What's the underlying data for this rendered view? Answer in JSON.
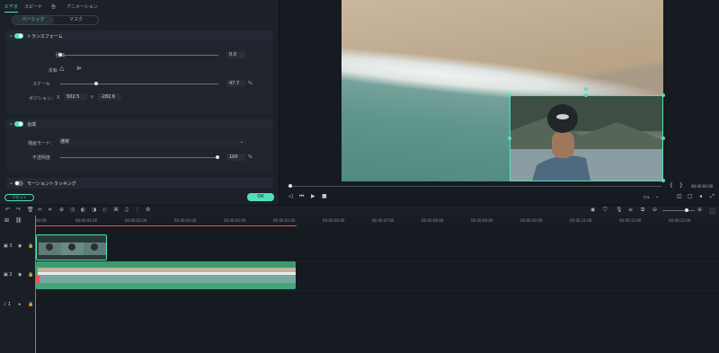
{
  "inspector": {
    "tabs": [
      "ビデオ",
      "スピード",
      "色",
      "アニメーション"
    ],
    "active_tab": 0,
    "subtabs": [
      "ベーシック",
      "マスク"
    ],
    "transform": {
      "title": "トランスフォーム",
      "enabled": true,
      "rotation_label": "回転",
      "rotation_value": "0.0",
      "flip_label": "反転",
      "scale_label": "スケール",
      "scale_value": "47.7",
      "scale_unit": "%",
      "scale_level": 0.477,
      "position_label": "ポジション：",
      "x_label": "X",
      "x_value": "502.5",
      "y_label": "Y",
      "y_value": "-282.6"
    },
    "composite": {
      "title": "合成",
      "enabled": true,
      "blend_label": "描画モード：",
      "blend_value": "通常",
      "opacity_label": "不透明度",
      "opacity_value": "100",
      "opacity_unit": "%",
      "opacity_level": 1.0
    },
    "motion_tracking": {
      "title": "モーショントラッキング",
      "enabled": false
    },
    "reset_label": "リセット",
    "ok_label": "OK"
  },
  "preview": {
    "time": "00:00:00:00",
    "quality": "フル",
    "progress": 0.0
  },
  "timeline": {
    "ruler": [
      "00:00",
      "00:00:01:00",
      "00:00:02:00",
      "00:00:03:00",
      "00:00:04:00",
      "00:00:05:00",
      "00:00:06:00",
      "00:00:07:00",
      "00:00:08:00",
      "00:00:09:00",
      "00:00:10:00",
      "00:00:11:00",
      "00:00:12:00",
      "00:00:13:00"
    ],
    "tracks": [
      "3",
      "2",
      "1"
    ]
  },
  "colors": {
    "accent": "#4fe1b6",
    "playhead": "#e8554e",
    "clip_green": "#3fa77a"
  }
}
